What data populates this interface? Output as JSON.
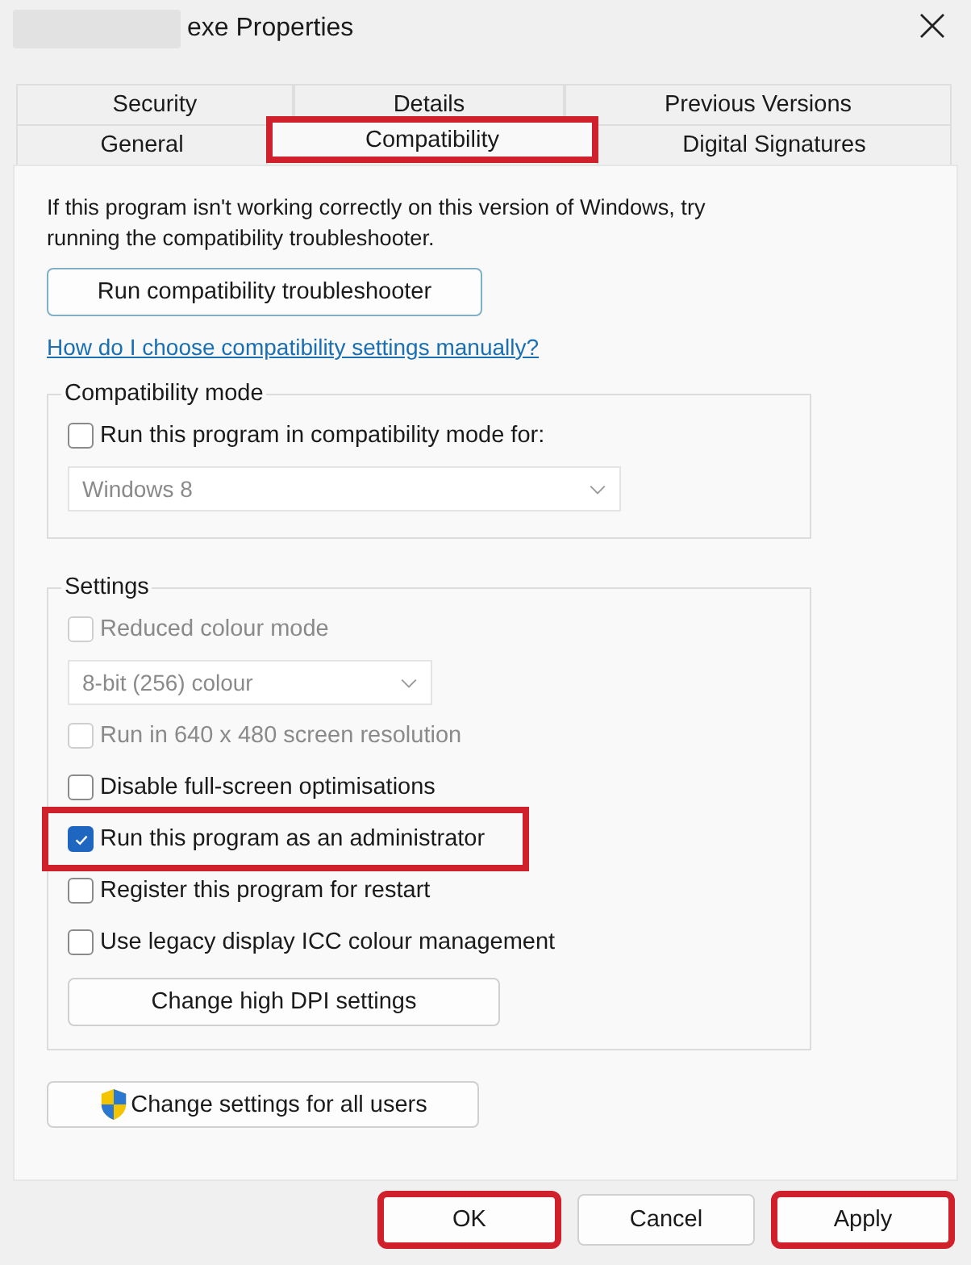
{
  "window": {
    "title": "exe Properties",
    "title_redacted": true
  },
  "tab_rows": [
    [
      {
        "label": "Security",
        "selected": false,
        "highlighted": false
      },
      {
        "label": "Details",
        "selected": false,
        "highlighted": false
      },
      {
        "label": "Previous Versions",
        "selected": false,
        "highlighted": false
      }
    ],
    [
      {
        "label": "General",
        "selected": false,
        "highlighted": false
      },
      {
        "label": "Compatibility",
        "selected": true,
        "highlighted": true
      },
      {
        "label": "Digital Signatures",
        "selected": false,
        "highlighted": false
      }
    ]
  ],
  "intro": "If this program isn't working correctly on this version of Windows, try running the compatibility troubleshooter.",
  "troubleshooter_button": "Run compatibility troubleshooter",
  "help_link": "How do I choose compatibility settings manually?",
  "groups": [
    {
      "title": "Compatibility mode",
      "items": [
        {
          "kind": "checkbox",
          "label": "Run this program in compatibility mode for:",
          "checked": false,
          "disabled": false
        },
        {
          "kind": "dropdown",
          "value": "Windows 8",
          "disabled": true
        }
      ]
    },
    {
      "title": "Settings",
      "items": [
        {
          "kind": "checkbox",
          "label": "Reduced colour mode",
          "checked": false,
          "disabled": true
        },
        {
          "kind": "dropdown",
          "value": "8-bit (256) colour",
          "disabled": true
        },
        {
          "kind": "checkbox",
          "label": "Run in 640 x 480 screen resolution",
          "checked": false,
          "disabled": true
        },
        {
          "kind": "checkbox",
          "label": "Disable full-screen optimisations",
          "checked": false,
          "disabled": false
        },
        {
          "kind": "checkbox",
          "label": "Run this program as an administrator",
          "checked": true,
          "disabled": false,
          "highlighted": true
        },
        {
          "kind": "checkbox",
          "label": "Register this program for restart",
          "checked": false,
          "disabled": false
        },
        {
          "kind": "checkbox",
          "label": "Use legacy display ICC colour management",
          "checked": false,
          "disabled": false
        },
        {
          "kind": "button",
          "label": "Change high DPI settings"
        }
      ]
    }
  ],
  "all_users_button": "Change settings for all users",
  "buttons": [
    {
      "label": "OK",
      "highlighted": true
    },
    {
      "label": "Cancel",
      "highlighted": false
    },
    {
      "label": "Apply",
      "highlighted": true
    }
  ]
}
